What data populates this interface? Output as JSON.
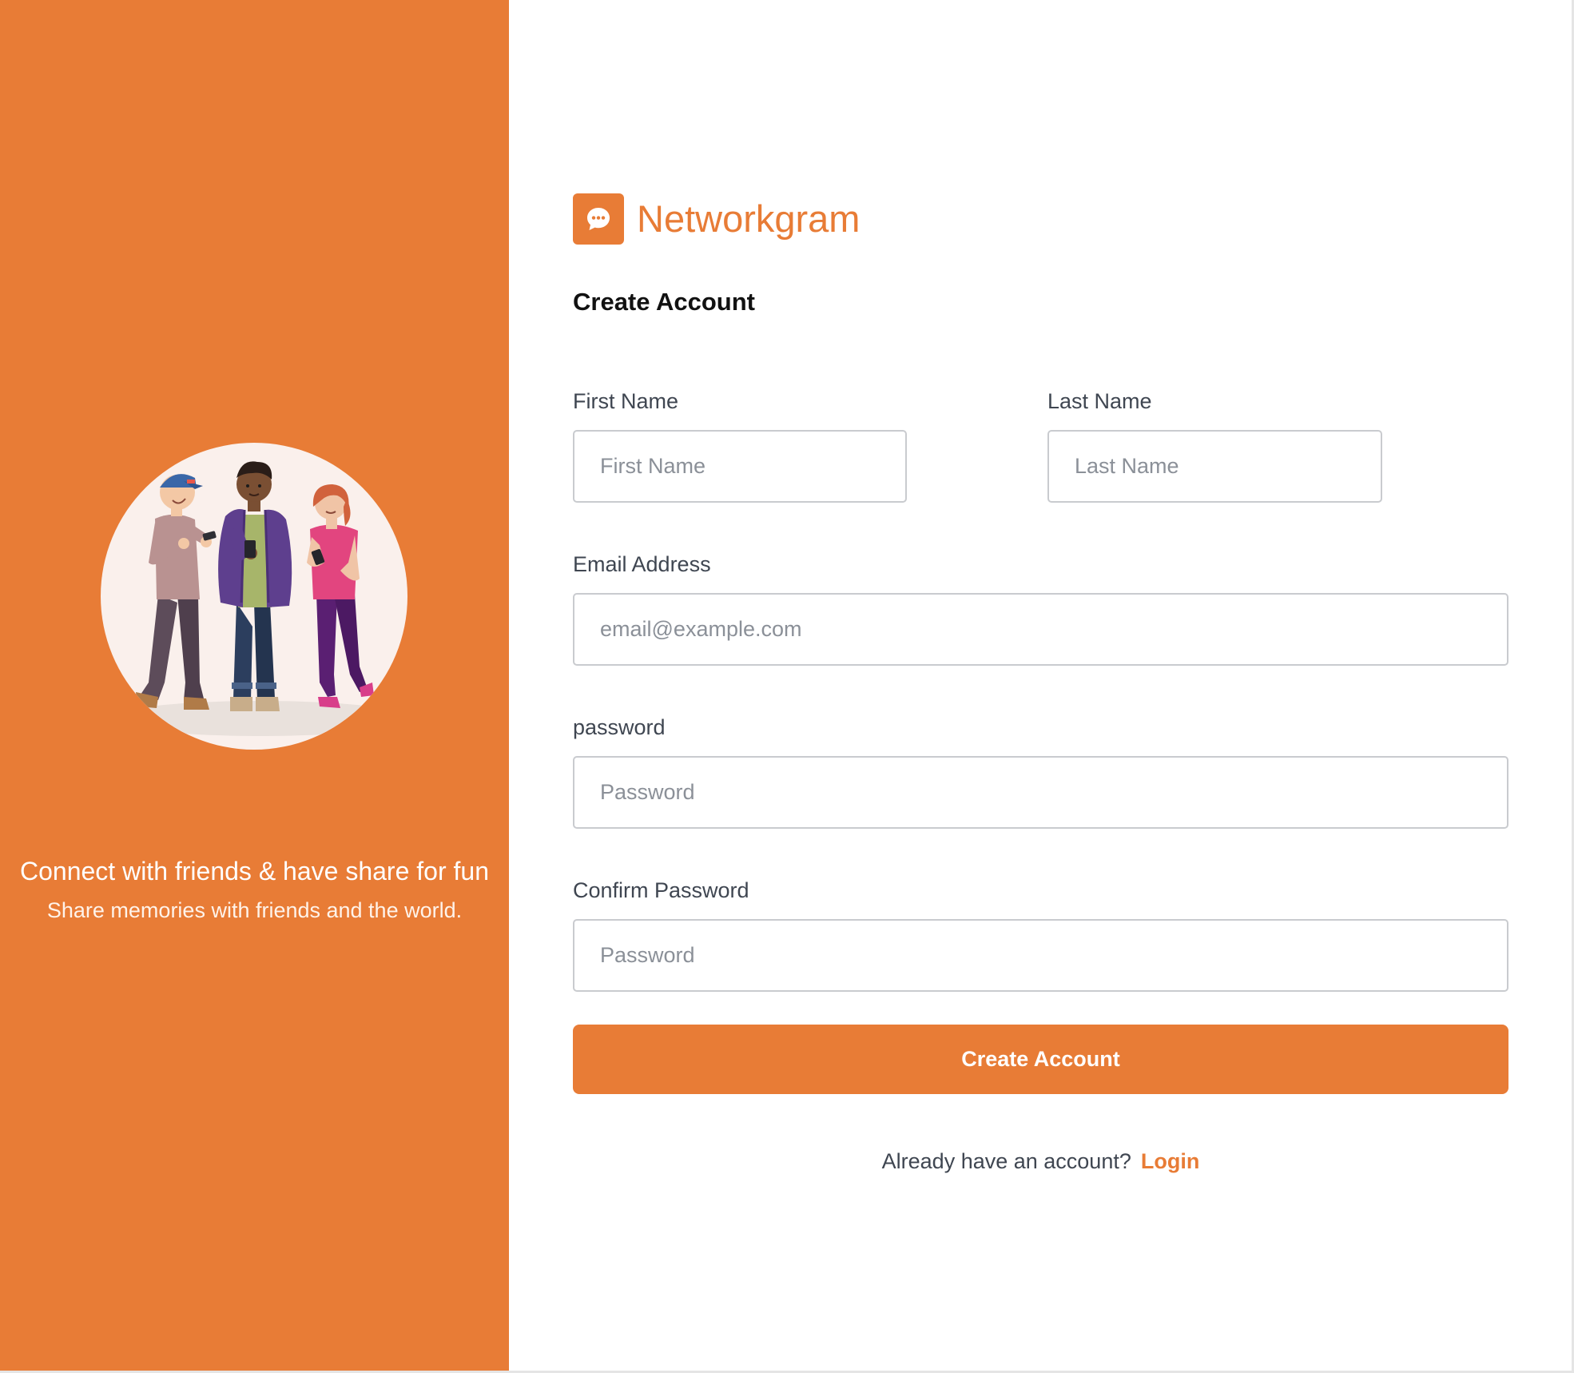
{
  "colors": {
    "accent": "#e87c36",
    "illustration_bg": "#faf0ec",
    "label_text": "#3f4651",
    "placeholder_text": "#8b9098",
    "input_border": "#c9cbcf"
  },
  "hero": {
    "illustration_icon": "people-with-phones-illustration",
    "title": "Connect with friends & have share for fun",
    "subtitle": "Share memories with friends and the world."
  },
  "brand": {
    "logo_icon": "chat-bubble-icon",
    "name": "Networkgram"
  },
  "form": {
    "title": "Create Account",
    "fields": {
      "first_name": {
        "label": "First Name",
        "placeholder": "First Name",
        "value": ""
      },
      "last_name": {
        "label": "Last Name",
        "placeholder": "Last Name",
        "value": ""
      },
      "email": {
        "label": "Email Address",
        "placeholder": "email@example.com",
        "value": ""
      },
      "password": {
        "label": "password",
        "placeholder": "Password",
        "value": ""
      },
      "confirm_password": {
        "label": "Confirm Password",
        "placeholder": "Password",
        "value": ""
      }
    },
    "submit_label": "Create Account",
    "login_prompt": "Already have an account?",
    "login_link": "Login"
  }
}
